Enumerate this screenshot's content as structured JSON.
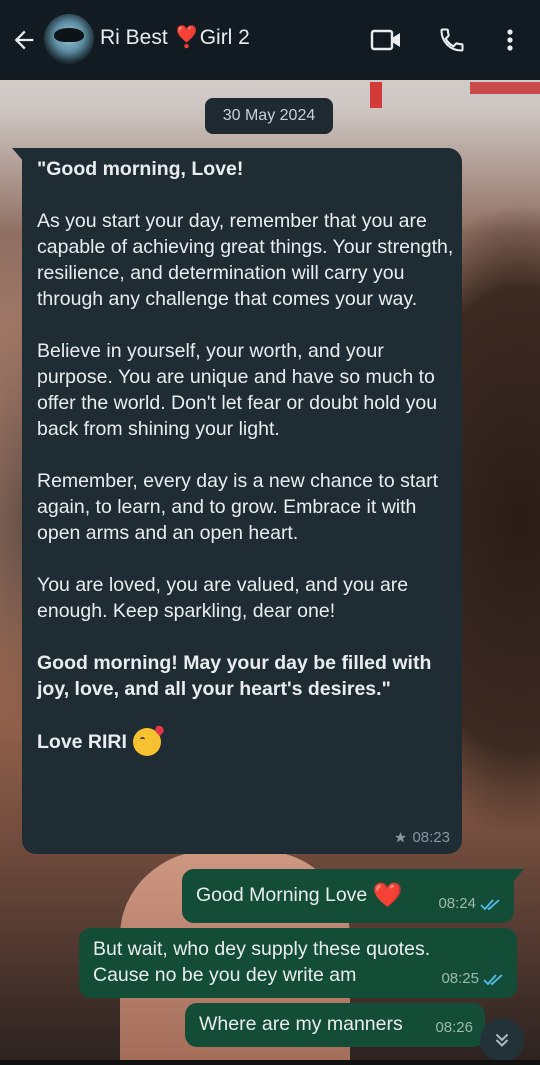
{
  "header": {
    "contact_name": "Ri Best ",
    "heart": "❣️",
    "contact_name_suffix": "Girl 2"
  },
  "date_chip": "30 May 2024",
  "incoming": {
    "paragraphs": [
      "\"Good morning, Love!",
      "As you start your day, remember that you are capable of achieving great things. Your strength, resilience, and determination will carry you through any challenge that comes your way.",
      "Believe in yourself, your worth, and your purpose. You are unique and have so much to offer the world. Don't let fear or doubt hold you back from shining your light.",
      "Remember, every day is a new chance to start again, to learn, and to grow. Embrace it with open arms and an open heart.",
      "You are loved, you are valued, and you are enough. Keep sparkling, dear one!",
      "Good morning! May your day be filled with joy, love, and all your heart's desires.\""
    ],
    "signature": "Love RIRI",
    "time": "08:23"
  },
  "outgoing": [
    {
      "text": "Good Morning Love",
      "emoji": "❤️",
      "time": "08:24"
    },
    {
      "text_line1": "But wait, who dey supply these quotes.",
      "text_line2": "Cause no be you dey write am",
      "time": "08:25"
    },
    {
      "text": "Where are my manners",
      "time": "08:26"
    }
  ],
  "colors": {
    "header_bg": "#121b22",
    "incoming_bubble": "#1f2c33",
    "outgoing_bubble": "#144d37",
    "read_tick": "#53bdeb"
  },
  "icons": [
    "back-arrow-icon",
    "video-call-icon",
    "voice-call-icon",
    "more-options-icon",
    "star-icon",
    "double-check-icon",
    "scroll-down-icon"
  ]
}
